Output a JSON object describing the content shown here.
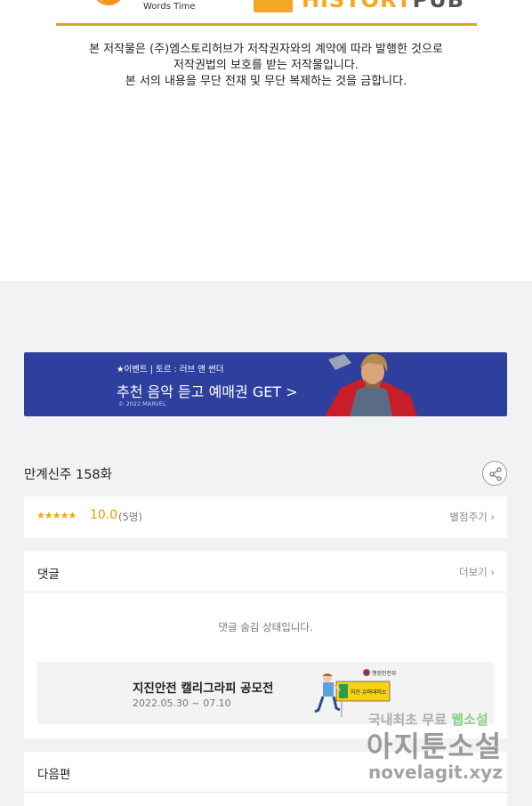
{
  "header": {
    "left_logo_text": "Words Time",
    "right_logo_text_1": "HISTORY",
    "right_logo_text_2": "PUB"
  },
  "copyright": {
    "line1": "본 저작물은 (주)엠스토리허브가 저작권자와의 계약에 따라 발행한 것으로",
    "line2": "저작권법의 보호를 받는 저작물입니다.",
    "line3": "본 서의 내용을 무단 전재 및 무단 복제하는 것을 금합니다."
  },
  "banner": {
    "event": "★이벤트 | 토르 : 러브 앤 썬더",
    "main": "추천 음악 듣고 예매권 GET >",
    "copy": "© 2022 MARVEL",
    "bg_color": "#2e3f9e"
  },
  "episode": {
    "title": "만계신주 158화",
    "share_icon": "share-icon"
  },
  "rating": {
    "stars": "★★★★★",
    "score": "10.0",
    "count": "(5명)",
    "rate_link": "별점주기"
  },
  "comments": {
    "label": "댓글",
    "more": "더보기",
    "hidden_message": "댓글 숨김 상태입니다."
  },
  "ad": {
    "title": "지진안전 캘리그라피 공모전",
    "date": "2022.05.30 ~ 07.10",
    "sign_text": "지진 슈퍼대피소",
    "ministry": "행정안전부"
  },
  "next": {
    "label": "다음편"
  },
  "watermark": {
    "line1_a": "국내최초 무료 ",
    "line1_b": "웹소설",
    "line2": "아지툰소설",
    "line3": "novelagit.xyz"
  }
}
